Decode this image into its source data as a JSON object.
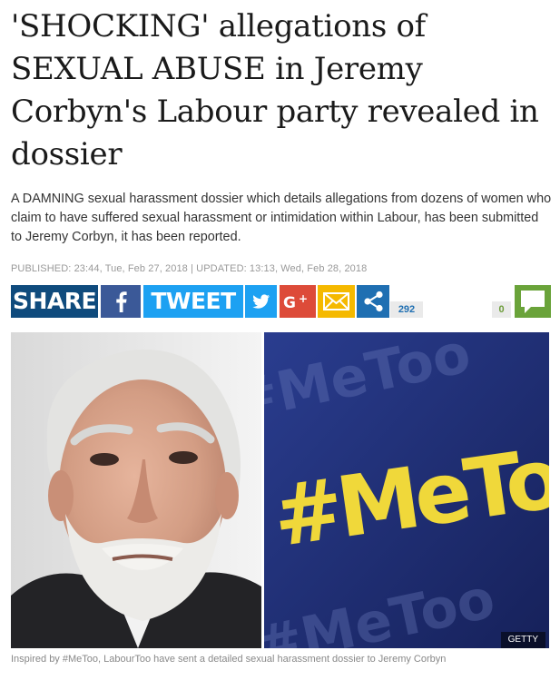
{
  "article": {
    "headline": "'SHOCKING' allegations of SEXUAL ABUSE in Jeremy Corbyn's Labour party revealed in dossier",
    "standfirst": "A DAMNING sexual harassment dossier which details allegations from dozens of women who claim to have suffered sexual harassment or intimidation within Labour, has been submitted to Jeremy Corbyn, it has been reported.",
    "dateline": "PUBLISHED: 23:44, Tue, Feb 27, 2018 | UPDATED: 13:13, Wed, Feb 28, 2018"
  },
  "share_bar": {
    "share_label": "SHARE",
    "tweet_label": "TWEET",
    "share_count": "292",
    "comment_count": "0",
    "icons": [
      "facebook-icon",
      "twitter-icon",
      "google-plus-icon",
      "email-icon",
      "share-icon",
      "comment-icon"
    ],
    "colors": {
      "share": "#0f4b7d",
      "facebook": "#3b5998",
      "twitter": "#1da1f2",
      "google_plus": "#dd4b39",
      "email": "#f5b900",
      "share_icon": "#1f6fb2",
      "comment": "#6aa33a"
    }
  },
  "image": {
    "left_photo": "Jeremy Corbyn portrait",
    "right_sign_text": "#MeToo",
    "right_background_text": "#MeToo",
    "credit": "GETTY",
    "caption": "Inspired by #MeToo, LabourToo have sent a detailed sexual harassment dossier to Jeremy Corbyn"
  }
}
